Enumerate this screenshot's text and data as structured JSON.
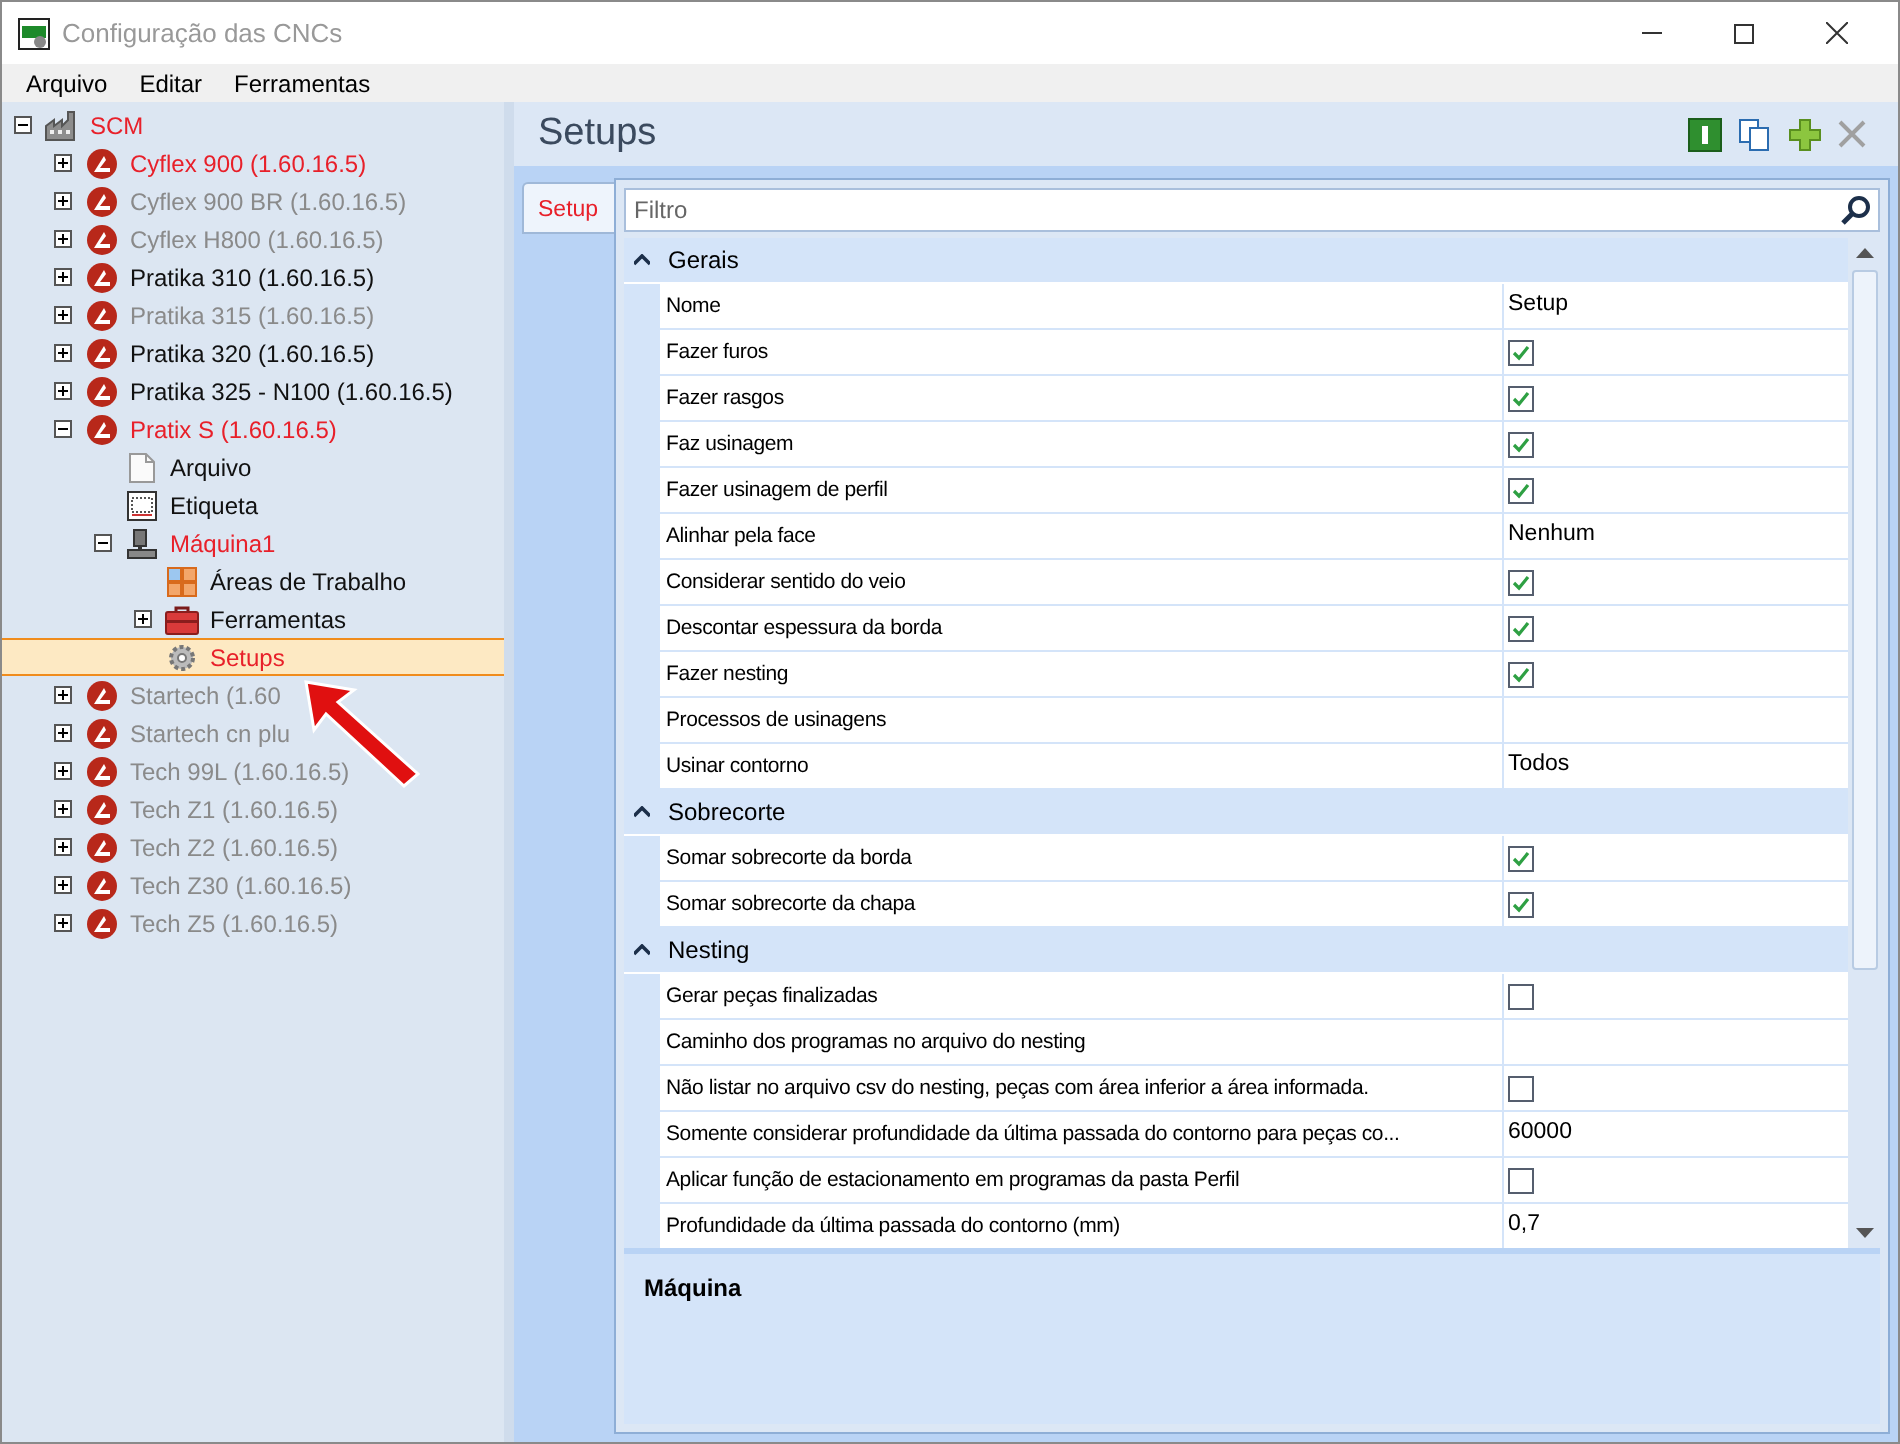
{
  "window": {
    "title": "Configuração das CNCs"
  },
  "menu": [
    "Arquivo",
    "Editar",
    "Ferramentas"
  ],
  "tree": [
    {
      "label": "SCM",
      "kind": "factory",
      "color": "#e8202a",
      "expanded": true,
      "selected": false,
      "children": [
        {
          "label": "Cyflex 900 (1.60.16.5)",
          "kind": "cnc",
          "color": "#e8202a",
          "expanded": false,
          "selected": false
        },
        {
          "label": "Cyflex 900 BR (1.60.16.5)",
          "kind": "cnc",
          "color": "#8a8a8a",
          "expanded": false,
          "selected": false
        },
        {
          "label": "Cyflex H800 (1.60.16.5)",
          "kind": "cnc",
          "color": "#8a8a8a",
          "expanded": false,
          "selected": false
        },
        {
          "label": "Pratika 310 (1.60.16.5)",
          "kind": "cnc",
          "color": "#111111",
          "expanded": false,
          "selected": false
        },
        {
          "label": "Pratika 315 (1.60.16.5)",
          "kind": "cnc",
          "color": "#8a8a8a",
          "expanded": false,
          "selected": false
        },
        {
          "label": "Pratika 320 (1.60.16.5)",
          "kind": "cnc",
          "color": "#111111",
          "expanded": false,
          "selected": false
        },
        {
          "label": "Pratika 325 - N100 (1.60.16.5)",
          "kind": "cnc",
          "color": "#111111",
          "expanded": false,
          "selected": false
        },
        {
          "label": "Pratix S (1.60.16.5)",
          "kind": "cnc",
          "color": "#e8202a",
          "expanded": true,
          "selected": false,
          "children": [
            {
              "label": "Arquivo",
              "kind": "file",
              "color": "#111111",
              "selected": false
            },
            {
              "label": "Etiqueta",
              "kind": "label",
              "color": "#111111",
              "selected": false
            },
            {
              "label": "Máquina1",
              "kind": "machine",
              "color": "#e8202a",
              "expanded": true,
              "selected": false,
              "children": [
                {
                  "label": "Áreas de Trabalho",
                  "kind": "areas",
                  "color": "#111111",
                  "selected": false
                },
                {
                  "label": "Ferramentas",
                  "kind": "toolbox",
                  "color": "#111111",
                  "expanded": false,
                  "selected": false
                },
                {
                  "label": "Setups",
                  "kind": "gear",
                  "color": "#e8202a",
                  "selected": true
                }
              ]
            }
          ]
        },
        {
          "label": "Startech (1.60",
          "kind": "cnc",
          "color": "#8a8a8a",
          "expanded": false,
          "selected": false
        },
        {
          "label": "Startech cn plu",
          "kind": "cnc",
          "color": "#8a8a8a",
          "expanded": false,
          "selected": false
        },
        {
          "label": "Tech 99L (1.60.16.5)",
          "kind": "cnc",
          "color": "#8a8a8a",
          "expanded": false,
          "selected": false
        },
        {
          "label": "Tech Z1 (1.60.16.5)",
          "kind": "cnc",
          "color": "#8a8a8a",
          "expanded": false,
          "selected": false
        },
        {
          "label": "Tech Z2 (1.60.16.5)",
          "kind": "cnc",
          "color": "#8a8a8a",
          "expanded": false,
          "selected": false
        },
        {
          "label": "Tech Z30 (1.60.16.5)",
          "kind": "cnc",
          "color": "#8a8a8a",
          "expanded": false,
          "selected": false
        },
        {
          "label": "Tech Z5 (1.60.16.5)",
          "kind": "cnc",
          "color": "#8a8a8a",
          "expanded": false,
          "selected": false
        }
      ]
    }
  ],
  "panel": {
    "title": "Setups",
    "tabs": [
      {
        "label": "Setup",
        "selected": true
      }
    ],
    "filter": {
      "placeholder": "Filtro"
    },
    "grid": {
      "categories": [
        {
          "name": "Gerais",
          "expanded": true,
          "rows": [
            {
              "name": "Nome",
              "kind": "text",
              "value": "Setup"
            },
            {
              "name": "Fazer furos",
              "kind": "check",
              "checked": true
            },
            {
              "name": "Fazer rasgos",
              "kind": "check",
              "checked": true
            },
            {
              "name": "Faz usinagem",
              "kind": "check",
              "checked": true
            },
            {
              "name": "Fazer usinagem de perfil",
              "kind": "check",
              "checked": true
            },
            {
              "name": "Alinhar pela face",
              "kind": "text",
              "value": "Nenhum"
            },
            {
              "name": "Considerar sentido do veio",
              "kind": "check",
              "checked": true
            },
            {
              "name": "Descontar espessura da borda",
              "kind": "check",
              "checked": true
            },
            {
              "name": "Fazer nesting",
              "kind": "check",
              "checked": true
            },
            {
              "name": "Processos de usinagens",
              "kind": "text"
            },
            {
              "name": "Usinar contorno",
              "kind": "text",
              "value": "Todos"
            }
          ]
        },
        {
          "name": "Sobrecorte",
          "expanded": true,
          "rows": [
            {
              "name": "Somar sobrecorte da borda",
              "kind": "check",
              "checked": true
            },
            {
              "name": "Somar sobrecorte da chapa",
              "kind": "check",
              "checked": true
            }
          ]
        },
        {
          "name": "Nesting",
          "expanded": true,
          "rows": [
            {
              "name": "Gerar peças finalizadas",
              "kind": "check",
              "checked": false
            },
            {
              "name": "Caminho dos programas no arquivo do nesting",
              "kind": "text"
            },
            {
              "name": "Não listar no arquivo csv do nesting, peças com área inferior a área informada.",
              "kind": "check",
              "checked": false
            },
            {
              "name": "Somente considerar profundidade da última passada do contorno para peças co...",
              "kind": "text",
              "value": "60000"
            },
            {
              "name": "Aplicar função de estacionamento em programas da pasta Perfil",
              "kind": "check",
              "checked": false
            },
            {
              "name": "Profundidade da última passada do contorno (mm)",
              "kind": "text",
              "value": "0,7"
            }
          ]
        }
      ]
    },
    "description": {
      "title": "Máquina"
    }
  }
}
